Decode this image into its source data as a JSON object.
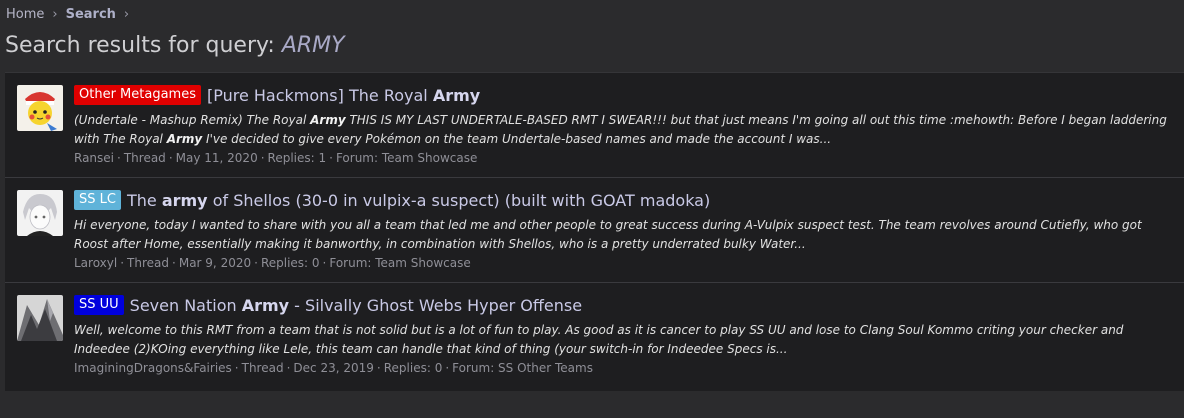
{
  "breadcrumb": {
    "items": [
      {
        "label": "Home"
      },
      {
        "label": "Search"
      }
    ]
  },
  "page": {
    "title_prefix": "Search results for query: ",
    "query": "ARMY"
  },
  "results": [
    {
      "prefix": "Other Metagames",
      "prefix_color": "#e00000",
      "title_before": "[Pure Hackmons] The Royal ",
      "title_highlight": "Army",
      "title_after": "",
      "snippet_1": "(Undertale - Mashup Remix) The Royal ",
      "snippet_hl_1": "Army",
      "snippet_2": " THIS IS MY LAST UNDERTALE-BASED RMT I SWEAR!!! but that just means I'm going all out this time :mehowth: Before I began laddering with The Royal ",
      "snippet_hl_2": "Army",
      "snippet_3": " I've decided to give every Pokémon on the team Undertale-based names and made the account I was...",
      "author": "Ransei",
      "type": "Thread",
      "date": "May 11, 2020",
      "replies": "Replies: 1",
      "forum": "Forum: Team Showcase"
    },
    {
      "prefix": "SS LC",
      "prefix_color": "#5fb3d9",
      "title_before": "The ",
      "title_highlight": "army",
      "title_after": " of Shellos (30-0 in vulpix-a suspect) (built with GOAT madoka)",
      "snippet_1": "Hi everyone, today I wanted to share with you all a team that led me and other people to great success during A-Vulpix suspect test. The team revolves around Cutiefly, who got Roost after Home, essentially making it banworthy, in combination with Shellos, who is a pretty underrated bulky Water...",
      "snippet_hl_1": "",
      "snippet_2": "",
      "snippet_hl_2": "",
      "snippet_3": "",
      "author": "Laroxyl",
      "type": "Thread",
      "date": "Mar 9, 2020",
      "replies": "Replies: 0",
      "forum": "Forum: Team Showcase"
    },
    {
      "prefix": "SS UU",
      "prefix_color": "#0000dd",
      "title_before": "Seven Nation ",
      "title_highlight": "Army",
      "title_after": " - Silvally Ghost Webs Hyper Offense",
      "snippet_1": "Well, welcome to this RMT from a team that is not solid but is a lot of fun to play. As good as it is cancer to play SS UU and lose to Clang Soul Kommo criting your checker and Indeedee (2)KOing everything like Lele, this team can handle that kind of thing (your switch-in for Indeedee Specs is...",
      "snippet_hl_1": "",
      "snippet_2": "",
      "snippet_hl_2": "",
      "snippet_3": "",
      "author": "ImaginingDragons&Fairies",
      "type": "Thread",
      "date": "Dec 23, 2019",
      "replies": "Replies: 0",
      "forum": "Forum: SS Other Teams"
    }
  ]
}
